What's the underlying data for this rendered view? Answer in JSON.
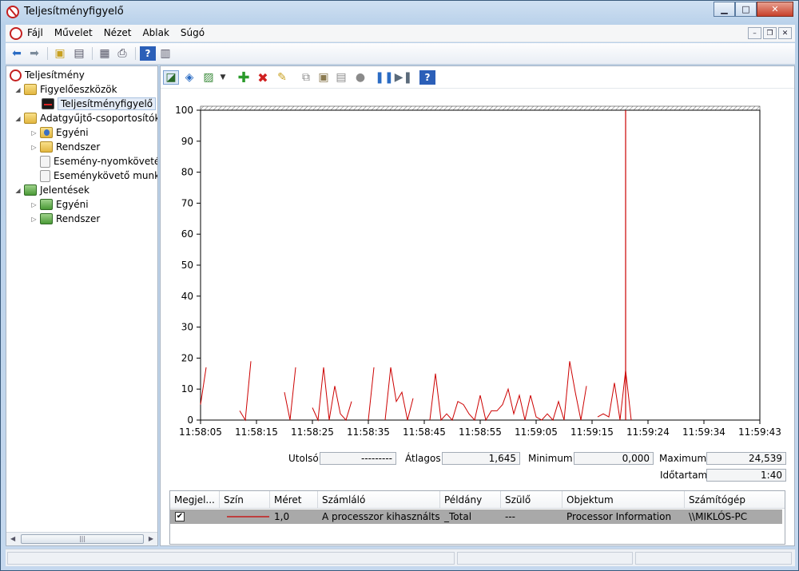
{
  "window": {
    "title": "Teljesítményfigyelő"
  },
  "menu": {
    "items": [
      "Fájl",
      "Művelet",
      "Nézet",
      "Ablak",
      "Súgó"
    ]
  },
  "tree": {
    "root": "Teljesítmény",
    "monitoring_tools": "Figyelőeszközök",
    "perf_monitor": "Teljesítményfigyelő",
    "collector_sets": "Adatgyűjtő-csoportosítók",
    "cs_custom": "Egyéni",
    "cs_system": "Rendszer",
    "cs_trace": "Esemény-nyomkövetés",
    "cs_startup": "Eseménykövető munka",
    "reports": "Jelentések",
    "rep_custom": "Egyéni",
    "rep_system": "Rendszer"
  },
  "stats": {
    "last_label": "Utolsó",
    "last_value": "---------",
    "avg_label": "Átlagos",
    "avg_value": "1,645",
    "min_label": "Minimum",
    "min_value": "0,000",
    "max_label": "Maximum",
    "max_value": "24,539",
    "duration_label": "Időtartam",
    "duration_value": "1:40"
  },
  "legend": {
    "headers": [
      "Megjel...",
      "Szín",
      "Méret",
      "Számláló",
      "Példány",
      "Szülő",
      "Objektum",
      "Számítógép"
    ],
    "row": {
      "checked": "✔",
      "size": "1,0",
      "counter": "A processzor kihasználtsá...",
      "instance": "_Total",
      "parent": "---",
      "object": "Processor Information",
      "computer": "\\\\MIKLÓS-PC"
    }
  },
  "colors": {
    "series": "#cc0000",
    "cursor": "#cc0000"
  },
  "chart_data": {
    "type": "line",
    "title": "",
    "xlabel": "",
    "ylabel": "",
    "ylim": [
      0,
      100
    ],
    "yticks": [
      0,
      10,
      20,
      30,
      40,
      50,
      60,
      70,
      80,
      90,
      100
    ],
    "xticks": [
      "11:58:05",
      "11:58:15",
      "11:58:25",
      "11:58:35",
      "11:58:45",
      "11:58:55",
      "11:59:05",
      "11:59:15",
      "11:59:24",
      "11:59:34",
      "11:59:43"
    ],
    "grid": false,
    "current_time_index": 76,
    "series": [
      {
        "values": [
          5,
          17,
          null,
          null,
          null,
          null,
          null,
          3,
          0,
          19,
          null,
          null,
          null,
          null,
          null,
          9,
          0,
          17,
          null,
          null,
          4,
          0,
          17,
          0,
          11,
          2,
          0,
          6,
          null,
          null,
          0,
          17,
          null,
          0,
          17,
          6,
          9,
          0,
          7,
          null,
          null,
          0,
          15,
          0,
          2,
          0,
          6,
          5,
          2,
          0,
          8,
          0,
          3,
          3,
          5,
          10,
          2,
          8,
          0,
          8,
          1,
          0,
          2,
          0,
          6,
          0,
          19,
          9,
          0,
          11,
          null,
          1,
          2,
          1,
          12,
          0,
          16,
          0
        ]
      }
    ]
  }
}
